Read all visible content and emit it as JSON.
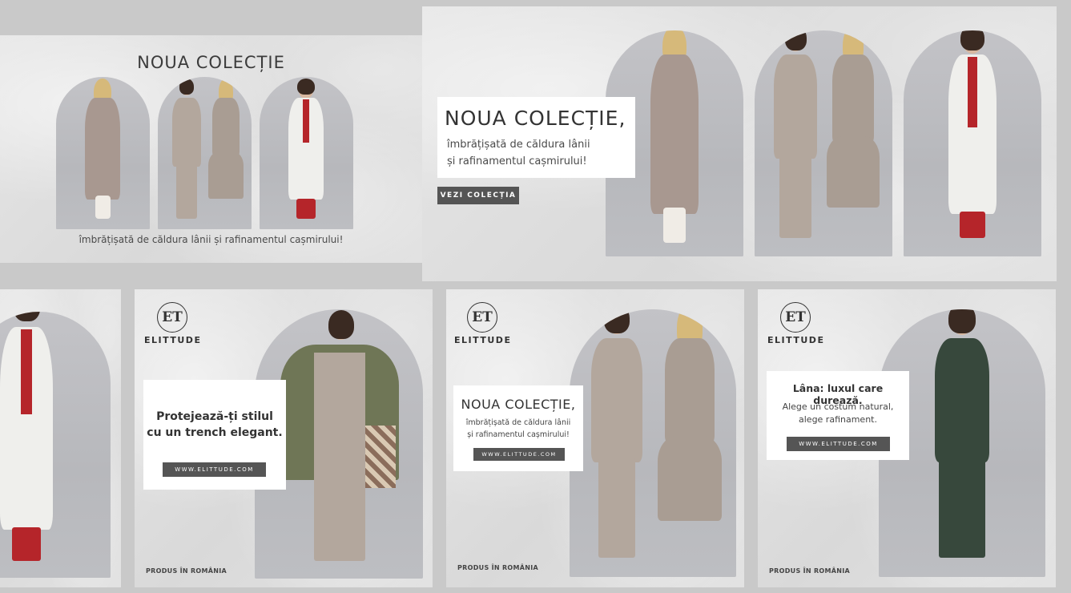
{
  "colors": {
    "background": "#c9c9c9",
    "card": "#e2e2e2",
    "button": "#555555",
    "coat_beige": "#a89890",
    "suit_taupe": "#b3a79d",
    "coat_white": "#efefec",
    "accent_red": "#b5252a",
    "trench_olive": "#6f7656",
    "suit_green": "#37483c"
  },
  "banner_top_left": {
    "headline": "NOUA COLECȚIE",
    "subtitle": "îmbrățișată de căldura lânii și rafinamentul cașmirului!"
  },
  "banner_top_right": {
    "headline": "NOUA COLECȚIE,",
    "subtitle_line1": "îmbrățișată de căldura lânii",
    "subtitle_line2": "și rafinamentul cașmirului!",
    "button": "VEZI COLECȚIA"
  },
  "brand": {
    "logo_letters": "ET",
    "name": "ELITTUDE",
    "made_in": "PRODUS ÎN ROMÂNIA",
    "url": "WWW.ELITTUDE.COM",
    "logo_icon": "et-monogram-icon"
  },
  "post_trench": {
    "line1": "Protejează-ți stilul",
    "line2": "cu un trench elegant."
  },
  "post_collection": {
    "headline": "NOUA COLECȚIE,",
    "line1": "îmbrățișată de căldura lânii",
    "line2": "și rafinamentul cașmirului!"
  },
  "post_wool": {
    "headline": "Lâna: luxul care durează.",
    "line1": "Alege un costum natural,",
    "line2": "alege rafinament."
  }
}
